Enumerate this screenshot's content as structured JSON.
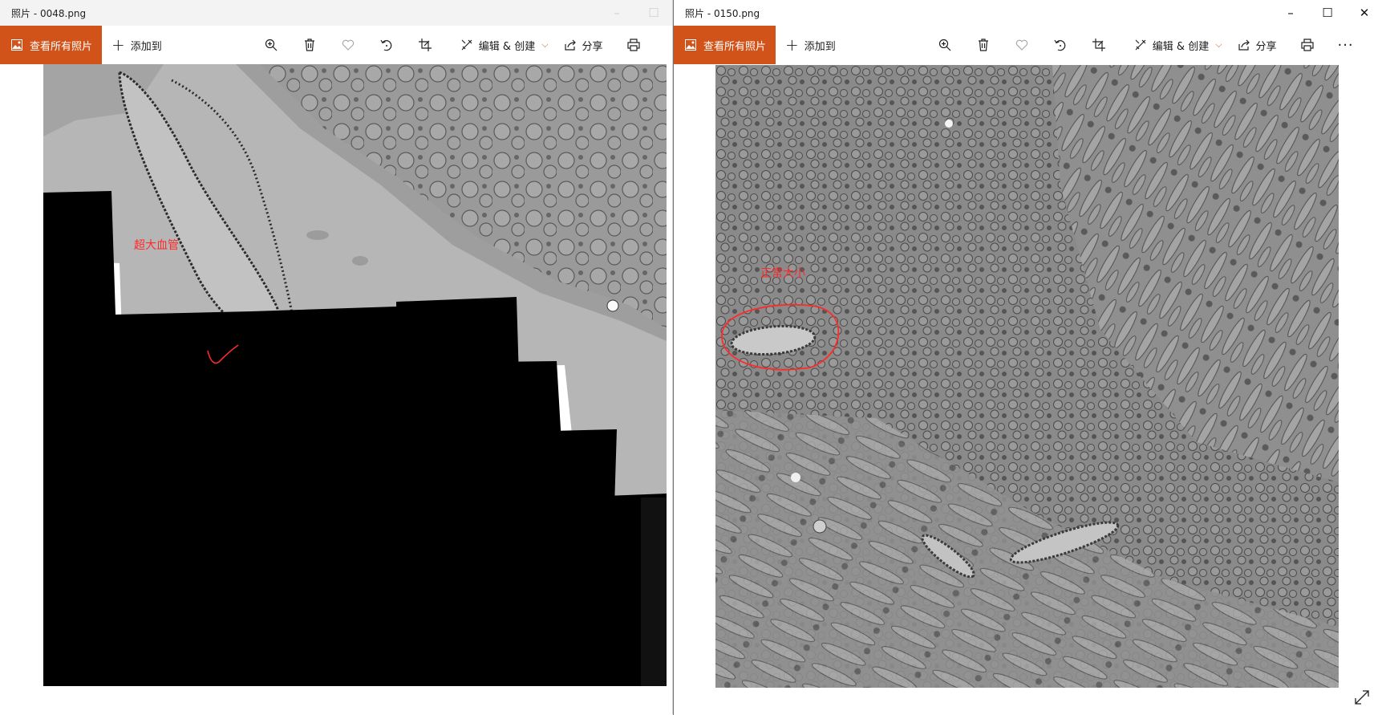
{
  "left_window": {
    "title": "照片 - 0048.png",
    "toolbar": {
      "see_all_label": "查看所有照片",
      "add_to_label": "添加到",
      "edit_create_label": "编辑 & 创建",
      "share_label": "分享"
    },
    "annotation_text": "超大血管"
  },
  "right_window": {
    "title": "照片 - 0150.png",
    "toolbar": {
      "see_all_label": "查看所有照片",
      "add_to_label": "添加到",
      "edit_create_label": "编辑 & 创建",
      "share_label": "分享",
      "more_label": "···"
    },
    "annotation_text": "正常大小"
  },
  "colors": {
    "accent": "#d25319",
    "annotation_red": "#ff2a2a"
  },
  "icons": [
    "image-icon",
    "plus-icon",
    "zoom-in-icon",
    "delete-icon",
    "heart-icon",
    "rotate-icon",
    "crop-icon",
    "edit-icon",
    "chevron-down-icon",
    "share-icon",
    "print-icon",
    "more-icon",
    "minimize-icon",
    "maximize-icon",
    "close-icon",
    "expand-icon"
  ]
}
